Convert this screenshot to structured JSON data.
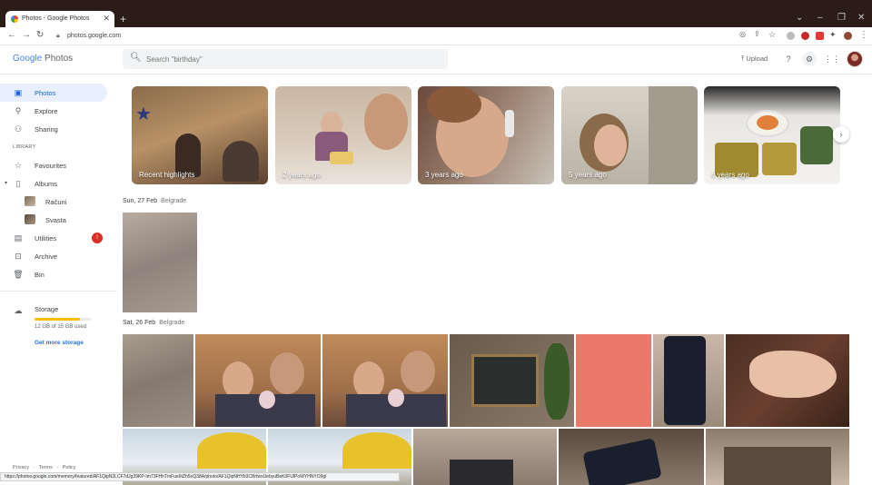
{
  "browser": {
    "tab_title": "Photos - Google Photos",
    "url": "photos.google.com",
    "status_url": "https://photos.google.com/memory/featured/AF1QipN2LCF7dJg39KP-Im73FHhTmFue6tZh5oQ38A/photo/AF1QipNHYb3CBrtwxUebyuBeK0FUlPoWYHNYO9gl"
  },
  "header": {
    "logo_google": "Google",
    "logo_photos": "Photos",
    "search_placeholder": "Search \"birthday\"",
    "upload_label": "Upload"
  },
  "sidebar": {
    "items": [
      {
        "label": "Photos",
        "icon": "photos-icon"
      },
      {
        "label": "Explore",
        "icon": "search-icon"
      },
      {
        "label": "Sharing",
        "icon": "people-icon"
      }
    ],
    "library_label": "LIBRARY",
    "library_items": [
      {
        "label": "Favourites",
        "icon": "star-icon"
      },
      {
        "label": "Albums",
        "icon": "album-icon"
      }
    ],
    "albums": [
      {
        "label": "Računi"
      },
      {
        "label": "Svasta"
      }
    ],
    "more_items": [
      {
        "label": "Utilities",
        "icon": "utilities-icon",
        "badge": "!"
      },
      {
        "label": "Archive",
        "icon": "archive-icon"
      },
      {
        "label": "Bin",
        "icon": "trash-icon"
      }
    ],
    "storage": {
      "label": "Storage",
      "used_text": "12 GB of 15 GB used",
      "used_fraction": 0.8,
      "get_more": "Get more storage"
    },
    "footer": {
      "privacy": "Privacy",
      "terms": "Terms",
      "policy": "Policy"
    }
  },
  "memories": [
    {
      "label": "Recent highlights"
    },
    {
      "label": "2 years ago"
    },
    {
      "label": "3 years ago"
    },
    {
      "label": "5 years ago"
    },
    {
      "label": "6 years ago"
    }
  ],
  "sections": [
    {
      "date": "Sun, 27 Feb",
      "location": "Belgrade"
    },
    {
      "date": "Sat, 26 Feb",
      "location": "Belgrade"
    }
  ],
  "colors": {
    "accent": "#1a73e8",
    "active_bg": "#e8f0fe",
    "badge": "#d93025",
    "storage_fill": "#fbbc05"
  }
}
